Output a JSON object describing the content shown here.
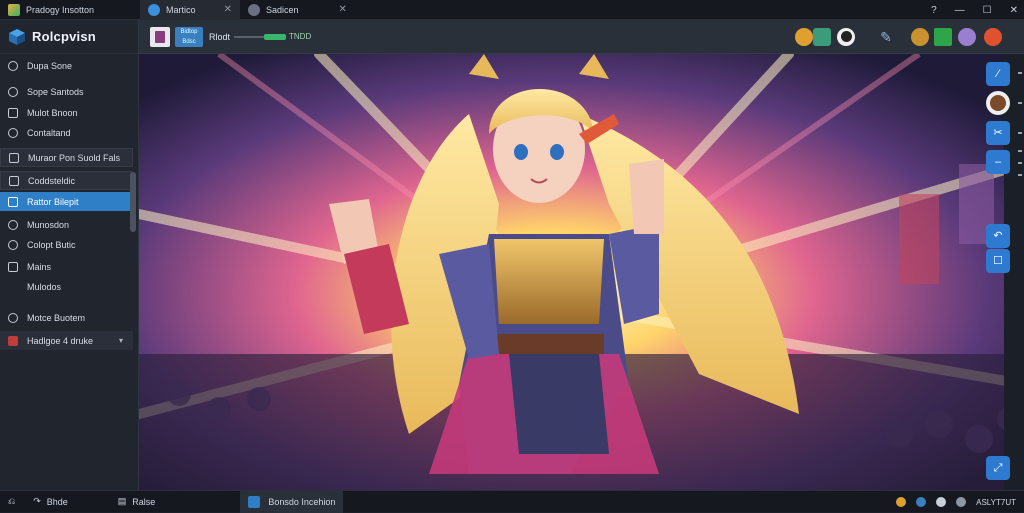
{
  "tabs": [
    {
      "label": "Pradogy Insotton"
    },
    {
      "label": "Martico"
    },
    {
      "label": "Sadicen"
    }
  ],
  "window_controls": [
    "?",
    "—",
    "☐",
    "✕"
  ],
  "sidebar": {
    "brand": "Rolcpvisn",
    "items": [
      {
        "label": "Dupa Sone"
      },
      {
        "label": "Sope Santods"
      },
      {
        "label": "Mulot Bnoon"
      },
      {
        "label": "Contaltand"
      },
      {
        "label": "Muraor Pon Suold Fals"
      },
      {
        "label": "Coddsteldic"
      },
      {
        "label": "Rattor Bilepit"
      },
      {
        "label": "Munosdon"
      },
      {
        "label": "Colopt Butic"
      },
      {
        "label": "Mains"
      },
      {
        "label": "Mulodos"
      },
      {
        "label": "Motce Buotem"
      },
      {
        "label": "Hadlgoe 4 druke"
      }
    ]
  },
  "toolbar": {
    "label": "Rlodt",
    "value": "TNDD",
    "chip_text": "Bidtop Bdsc"
  },
  "statusbar": {
    "back": "Bhde",
    "file": "Ralse",
    "active": "Bonsdo Incehion",
    "right_text": "ASLYT7UT"
  },
  "colors": {
    "accent": "#2f7fc6",
    "progress": "#39b86b"
  }
}
